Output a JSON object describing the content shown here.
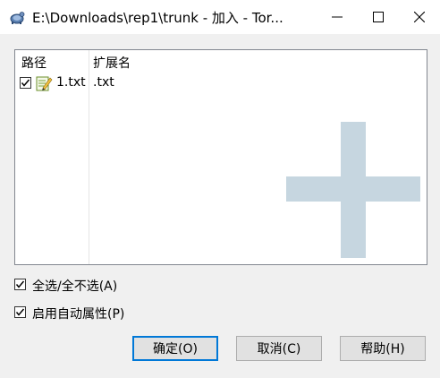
{
  "window": {
    "title": "E:\\Downloads\\rep1\\trunk - 加入 - Tor...",
    "app_icon": "tortoise-icon",
    "controls": {
      "minimize": "minimize-icon",
      "maximize": "maximize-icon",
      "close": "close-icon"
    }
  },
  "list": {
    "columns": [
      "路径",
      "扩展名"
    ],
    "rows": [
      {
        "checked": true,
        "name": "1.txt",
        "ext": ".txt",
        "icon": "text-file-icon"
      }
    ],
    "overlay_icon": "plus-add-icon"
  },
  "options": {
    "select_all": {
      "label": "全选/全不选(A)",
      "checked": true
    },
    "auto_props": {
      "label": "启用自动属性(P)",
      "checked": true
    }
  },
  "buttons": {
    "ok": "确定(O)",
    "cancel": "取消(C)",
    "help": "帮助(H)"
  },
  "colors": {
    "accent": "#0078d7",
    "overlay_plus": "#c6d6e0",
    "list_border": "#828790"
  }
}
